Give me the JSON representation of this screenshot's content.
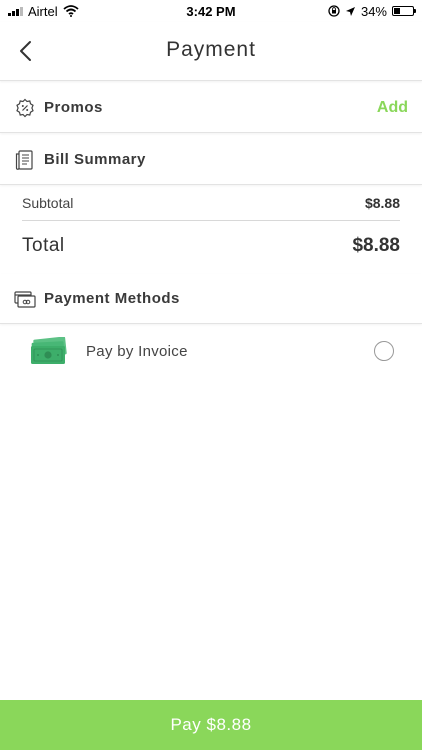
{
  "status": {
    "carrier": "Airtel",
    "time": "3:42 PM",
    "battery": "34%",
    "battery_level": 0.34
  },
  "header": {
    "title": "Payment"
  },
  "promos": {
    "label": "Promos",
    "action": "Add"
  },
  "bill": {
    "label": "Bill Summary",
    "subtotal_label": "Subtotal",
    "subtotal_value": "$8.88",
    "total_label": "Total",
    "total_value": "$8.88"
  },
  "payment_methods": {
    "label": "Payment Methods",
    "options": [
      {
        "label": "Pay by Invoice",
        "selected": false
      }
    ]
  },
  "footer": {
    "pay_label": "Pay $8.88"
  },
  "colors": {
    "accent": "#8ad75a",
    "cash_green": "#3dae6a"
  }
}
